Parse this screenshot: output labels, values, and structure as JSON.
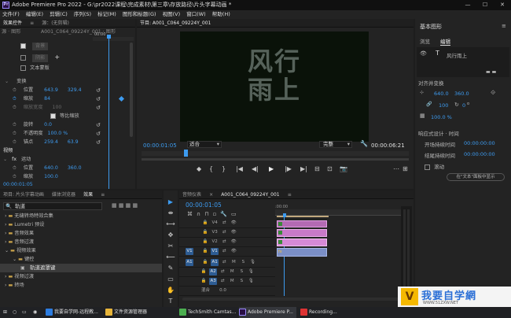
{
  "window": {
    "title": "Adobe Premiere Pro 2022 - G:\\pr2022课程\\完成素材\\第三章\\存放路径\\片头字幕动画 *",
    "minimize": "—",
    "maximize": "☐",
    "close": "✕"
  },
  "menu": [
    "文件(F)",
    "编辑(E)",
    "剪辑(C)",
    "序列(S)",
    "标记(M)",
    "图形和标题(G)",
    "视图(V)",
    "窗口(W)",
    "帮助(H)"
  ],
  "effect_controls": {
    "tab_label": "效果控件",
    "menu_glyph": "≡",
    "clip_label": "源 · 图形",
    "seq_label": "A001_C064_09224Y_001 · 图形",
    "tab_sub": "源：(无剪辑)",
    "ruler_time": "00:00",
    "layers": [
      {
        "label": "背景",
        "checked": true
      },
      {
        "label": "阴影",
        "checked": false
      }
    ],
    "text_mask_label": "文本蒙版",
    "transform": {
      "heading": "变换",
      "position": {
        "label": "位置",
        "x": "643.9",
        "y": "329.4"
      },
      "scale": {
        "label": "缩放",
        "value": "84"
      },
      "scale_width": {
        "label": "缩放宽度",
        "value": "100"
      },
      "uniform_scale": {
        "label": "等比缩放"
      },
      "rotation": {
        "label": "旋转",
        "value": "0.0"
      },
      "opacity": {
        "label": "不透明度",
        "value": "100.0 %"
      },
      "anchor": {
        "label": "锚点",
        "x": "259.4",
        "y": "63.9"
      }
    },
    "video_section": "视频",
    "motion": {
      "heading": "运动",
      "position": {
        "label": "位置",
        "x": "640.0",
        "y": "360.0"
      },
      "scale": {
        "label": "缩放",
        "value": "100.0"
      }
    },
    "timecode": "00:00:01:05"
  },
  "program_monitor": {
    "title": "节目: A001_C064_09224Y_001",
    "overlay_text": "风行\n雨上",
    "timecode": "00:00:01:05",
    "fit": "适合",
    "fit_options_glyph": "▾",
    "quality": "完整",
    "duration": "00:00:06:21",
    "transport": [
      "◆",
      "{",
      "}",
      "|◀",
      "◀|",
      "▶",
      "|▶",
      "▶|",
      "⊟",
      "⊡",
      "📷",
      "⋯",
      "⊞"
    ]
  },
  "essential_graphics": {
    "title": "基本图形",
    "menu_glyph": "≡",
    "tabs": [
      "浏览",
      "编辑"
    ],
    "layer_label": "风行雨上",
    "align_heading": "对齐并变换",
    "pos_x": "640.0",
    "pos_y": "360.0",
    "scale": "100",
    "rotation": "0",
    "rotation_unit": "o",
    "opacity": "100.0 %",
    "responsive_heading": "响应式设计 · 时间",
    "intro": "开场持续时间",
    "intro_val": "00:00:00:00",
    "outro": "结尾持续时间",
    "outro_val": "00:00:00:00",
    "roll": "滚动",
    "open_text_btn": "在\"文本\"面板中显示"
  },
  "project_panel": {
    "tabs": [
      "项目: 片头字幕动画",
      "媒体浏览器",
      "效果"
    ],
    "menu_glyph": "≡",
    "search": "轨道",
    "tree": [
      {
        "label": "无缝转场特效合集",
        "level": 0
      },
      {
        "label": "Lumetri 预设",
        "level": 0
      },
      {
        "label": "音频效果",
        "level": 0
      },
      {
        "label": "音频过渡",
        "level": 0
      },
      {
        "label": "视频效果",
        "level": 0
      },
      {
        "label": "键控",
        "level": 1
      },
      {
        "label": "轨道遮罩键",
        "level": 2,
        "selected": true
      },
      {
        "label": "视频过渡",
        "level": 0
      },
      {
        "label": "转场",
        "level": 0
      }
    ]
  },
  "tools": [
    "▶",
    "⇼",
    "⟷",
    "✥",
    "✂",
    "⟵",
    "✎",
    "▭",
    "✋",
    "T"
  ],
  "timeline": {
    "tabs": [
      "音频仪表",
      "A001_C064_09224Y_001"
    ],
    "close_glyph": "×",
    "menu_glyph": "≡",
    "timecode": "00:00:01:05",
    "ruler_start": ":00:00",
    "video_tracks": [
      "V4",
      "V3",
      "V2",
      "V1"
    ],
    "audio_tracks": [
      "A1",
      "A2",
      "A3"
    ],
    "src_v": "V1",
    "src_a": "A1",
    "mix_label": "混合",
    "mix_value": "0.0",
    "clip_fx": "fx",
    "clip_audio": "A"
  },
  "taskbar": {
    "items": [
      "我要自学网-远程教...",
      "文件资源管理器",
      "TechSmith Camtas...",
      "Adobe Premiere P...",
      "Recording..."
    ],
    "watermark": "我要自学網",
    "watermark_url": "WWW.51ZXW.NET"
  }
}
